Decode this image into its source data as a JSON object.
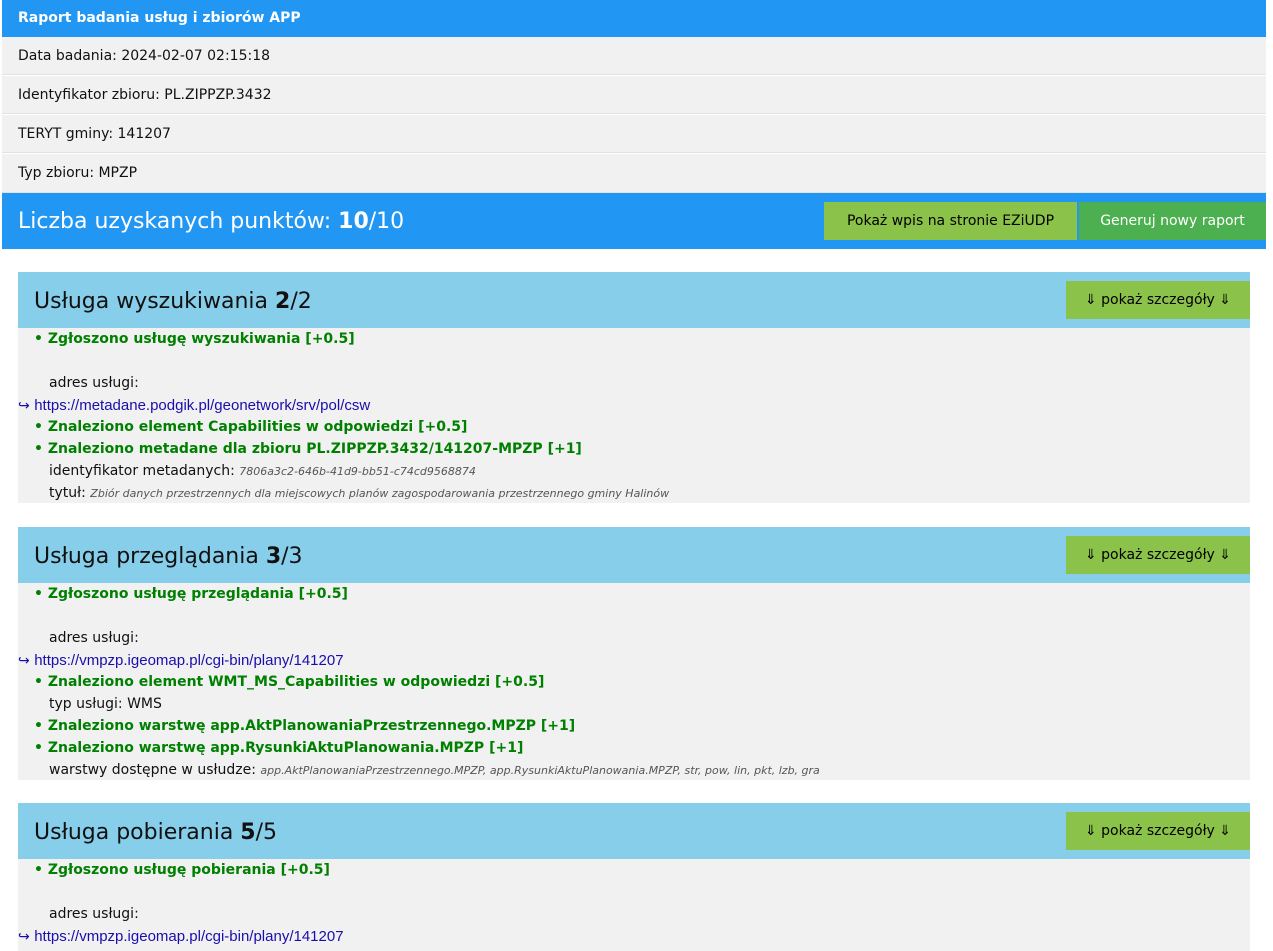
{
  "header": {
    "title": "Raport badania usług i zbiorów APP"
  },
  "info": {
    "date": "Data badania: 2024-02-07 02:15:18",
    "identifier": "Identyfikator zbioru: PL.ZIPPZP.3432",
    "teryt": "TERYT gminy: 141207",
    "type": "Typ zbioru: MPZP"
  },
  "score": {
    "label": "Liczba uzyskanych punktów: ",
    "value": "10",
    "max": "/10",
    "show_ez_button": "Pokaż wpis na stronie EZiUDP",
    "generate_button": "Generuj nowy raport"
  },
  "details_label": "⇓ pokaż szczegóły ⇓",
  "search": {
    "title": "Usługa wyszukiwania ",
    "score": "2",
    "max": "/2",
    "item1": "• Zgłoszono usługę wyszukiwania [+0.5]",
    "address_label": "adres usługi:",
    "arrow": "↪",
    "url": "https://metadane.podgik.pl/geonetwork/srv/pol/csw",
    "item2": "• Znaleziono element Capabilities w odpowiedzi [+0.5]",
    "item3": "• Znaleziono metadane dla zbioru PL.ZIPPZP.3432/141207-MPZP [+1]",
    "meta_id_label": "identyfikator metadanych: ",
    "meta_id_value": "7806a3c2-646b-41d9-bb51-c74cd9568874",
    "title_label": "tytuł: ",
    "title_value": "Zbiór danych przestrzennych dla miejscowych planów zagospodarowania przestrzennego gminy Halinów"
  },
  "view": {
    "title": "Usługa przeglądania ",
    "score": "3",
    "max": "/3",
    "item1": "• Zgłoszono usługę przeglądania [+0.5]",
    "address_label": "adres usługi:",
    "arrow": "↪",
    "url": "https://vmpzp.igeomap.pl/cgi-bin/plany/141207",
    "item2": "• Znaleziono element WMT_MS_Capabilities w odpowiedzi [+0.5]",
    "service_type": "typ usługi: WMS",
    "item3": "• Znaleziono warstwę app.AktPlanowaniaPrzestrzennego.MPZP [+1]",
    "item4": "• Znaleziono warstwę app.RysunkiAktuPlanowania.MPZP [+1]",
    "layers_label": "warstwy dostępne w usłudze: ",
    "layers_value": "app.AktPlanowaniaPrzestrzennego.MPZP, app.RysunkiAktuPlanowania.MPZP, str, pow, lin, pkt, lzb, gra"
  },
  "download": {
    "title": "Usługa pobierania ",
    "score": "5",
    "max": "/5",
    "item1": "• Zgłoszono usługę pobierania [+0.5]",
    "address_label": "adres usługi:",
    "arrow": "↪",
    "url": "https://vmpzp.igeomap.pl/cgi-bin/plany/141207"
  }
}
